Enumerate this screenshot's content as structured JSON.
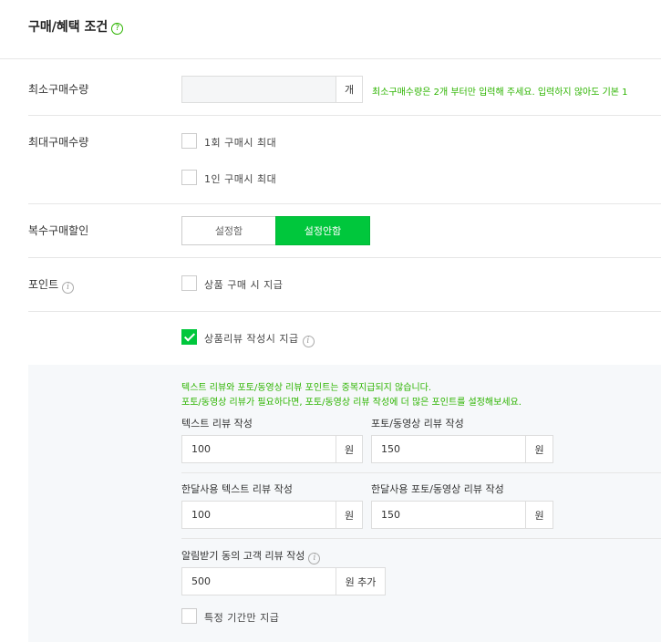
{
  "section": {
    "title": "구매/혜택 조건",
    "help_icon": "?"
  },
  "min_purchase": {
    "label": "최소구매수량",
    "value": "",
    "unit": "개",
    "hint": "최소구매수량은 2개 부터만 입력해 주세요. 입력하지 않아도 기본 1"
  },
  "max_purchase": {
    "label": "최대구매수량",
    "options": [
      {
        "label": "1회 구매시 최대",
        "checked": false
      },
      {
        "label": "1인 구매시 최대",
        "checked": false
      }
    ]
  },
  "multi_discount": {
    "label": "복수구매할인",
    "options": [
      "설정함",
      "설정안함"
    ],
    "selected": "설정안함"
  },
  "points": {
    "label": "포인트",
    "info_icon": "i",
    "purchase_option": {
      "label": "상품 구매 시 지급",
      "checked": false
    },
    "review_option": {
      "label": "상품리뷰 작성시 지급",
      "checked": true
    },
    "notice_line1": "텍스트 리뷰와 포토/동영상 리뷰 포인트는 중복지급되지 않습니다.",
    "notice_line2": "포토/동영상 리뷰가 필요하다면, 포토/동영상 리뷰 작성에 더 많은 포인트를 설정해보세요.",
    "text_review": {
      "label": "텍스트 리뷰 작성",
      "value": "100",
      "unit": "원"
    },
    "photo_review": {
      "label": "포토/동영상 리뷰 작성",
      "value": "150",
      "unit": "원"
    },
    "month_text_review": {
      "label": "한달사용 텍스트 리뷰 작성",
      "value": "100",
      "unit": "원"
    },
    "month_photo_review": {
      "label": "한달사용 포토/동영상 리뷰 작성",
      "value": "150",
      "unit": "원"
    },
    "alarm_review": {
      "label": "알림받기 동의 고객 리뷰 작성",
      "value": "500",
      "unit": "원 추가"
    },
    "period_option": {
      "label": "특정 기간만 지급",
      "checked": false
    }
  },
  "colors": {
    "accent_green": "#00c73c",
    "hint_green": "#2db400"
  }
}
